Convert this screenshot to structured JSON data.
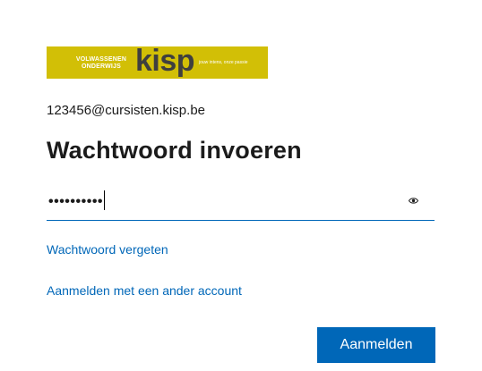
{
  "banner": {
    "line1": "VOLWASSENEN",
    "line2": "ONDERWIJS",
    "brand": "kisp",
    "tagline": "jouw intens, onze passie",
    "background_color": "#d2bf06"
  },
  "identity": "123456@cursisten.kisp.be",
  "title": "Wachtwoord invoeren",
  "password": {
    "masked_value": "••••••••••",
    "reveal_icon": "eye-icon"
  },
  "links": {
    "forgot": "Wachtwoord vergeten",
    "other_account": "Aanmelden met een ander account"
  },
  "signin_button": "Aanmelden",
  "accent_color": "#0067b8"
}
